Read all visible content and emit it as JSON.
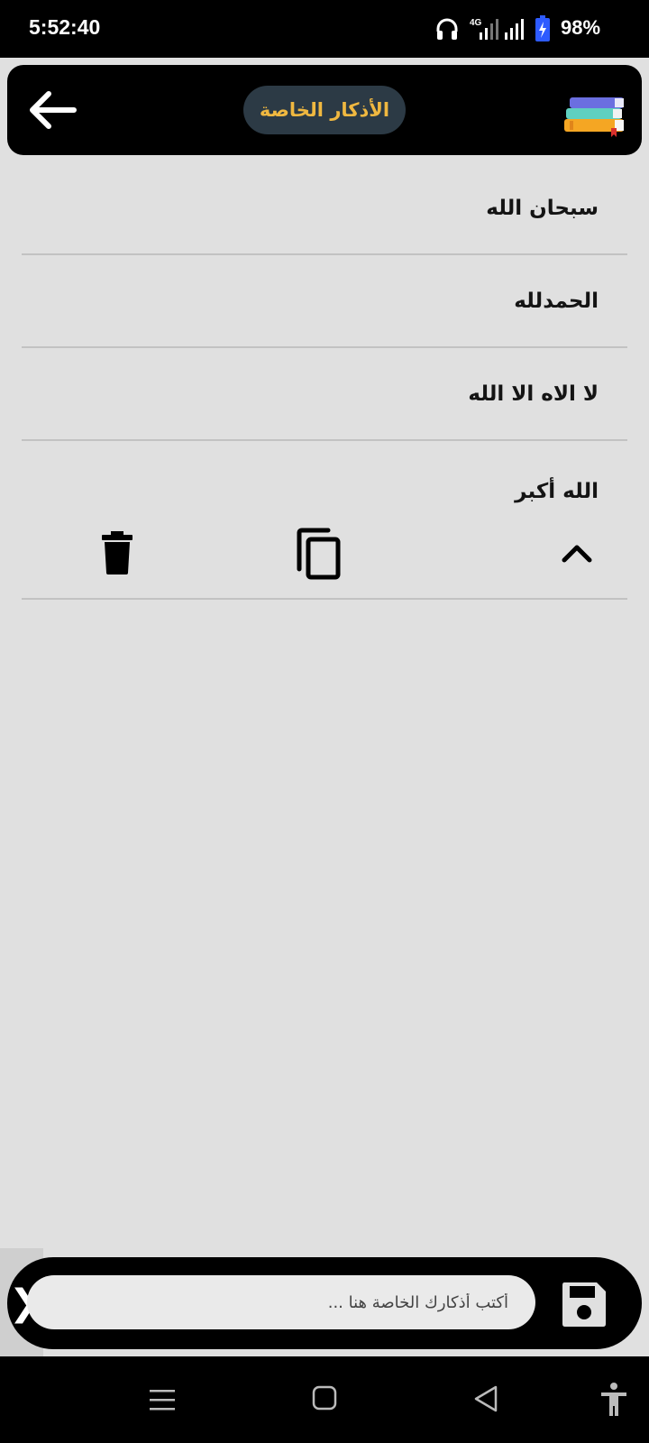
{
  "status_bar": {
    "time": "5:52:40",
    "network": "4G",
    "battery": "98%",
    "icons": [
      "headphones-icon",
      "signal-icon",
      "signal-icon",
      "battery-charging-icon"
    ]
  },
  "header": {
    "title": "الأذكار الخاصة",
    "back_icon": "arrow-left-icon",
    "logo_icon": "books-icon"
  },
  "list": {
    "items": [
      {
        "text": "سبحان الله"
      },
      {
        "text": "الحمدلله"
      },
      {
        "text": "لا الاه الا الله"
      },
      {
        "text": "الله أكبر"
      }
    ],
    "expanded_index": 3,
    "actions": [
      "trash-icon",
      "copy-icon",
      "chevron-up-icon"
    ]
  },
  "input_bar": {
    "placeholder": "أكتب أذكارك الخاصة هنا ...",
    "value": "",
    "drawer_chevron": "❯",
    "save_icon": "floppy-disk-icon"
  },
  "nav_bar": {
    "icons": [
      "menu-icon",
      "home-icon",
      "back-triangle-icon",
      "accessibility-icon"
    ]
  },
  "colors": {
    "background": "#e0e0e0",
    "header_bg": "#000000",
    "title_pill": "#2c3a45",
    "title_text": "#f0b840",
    "divider": "#c2c2c2",
    "battery_accent": "#2e5bff"
  }
}
